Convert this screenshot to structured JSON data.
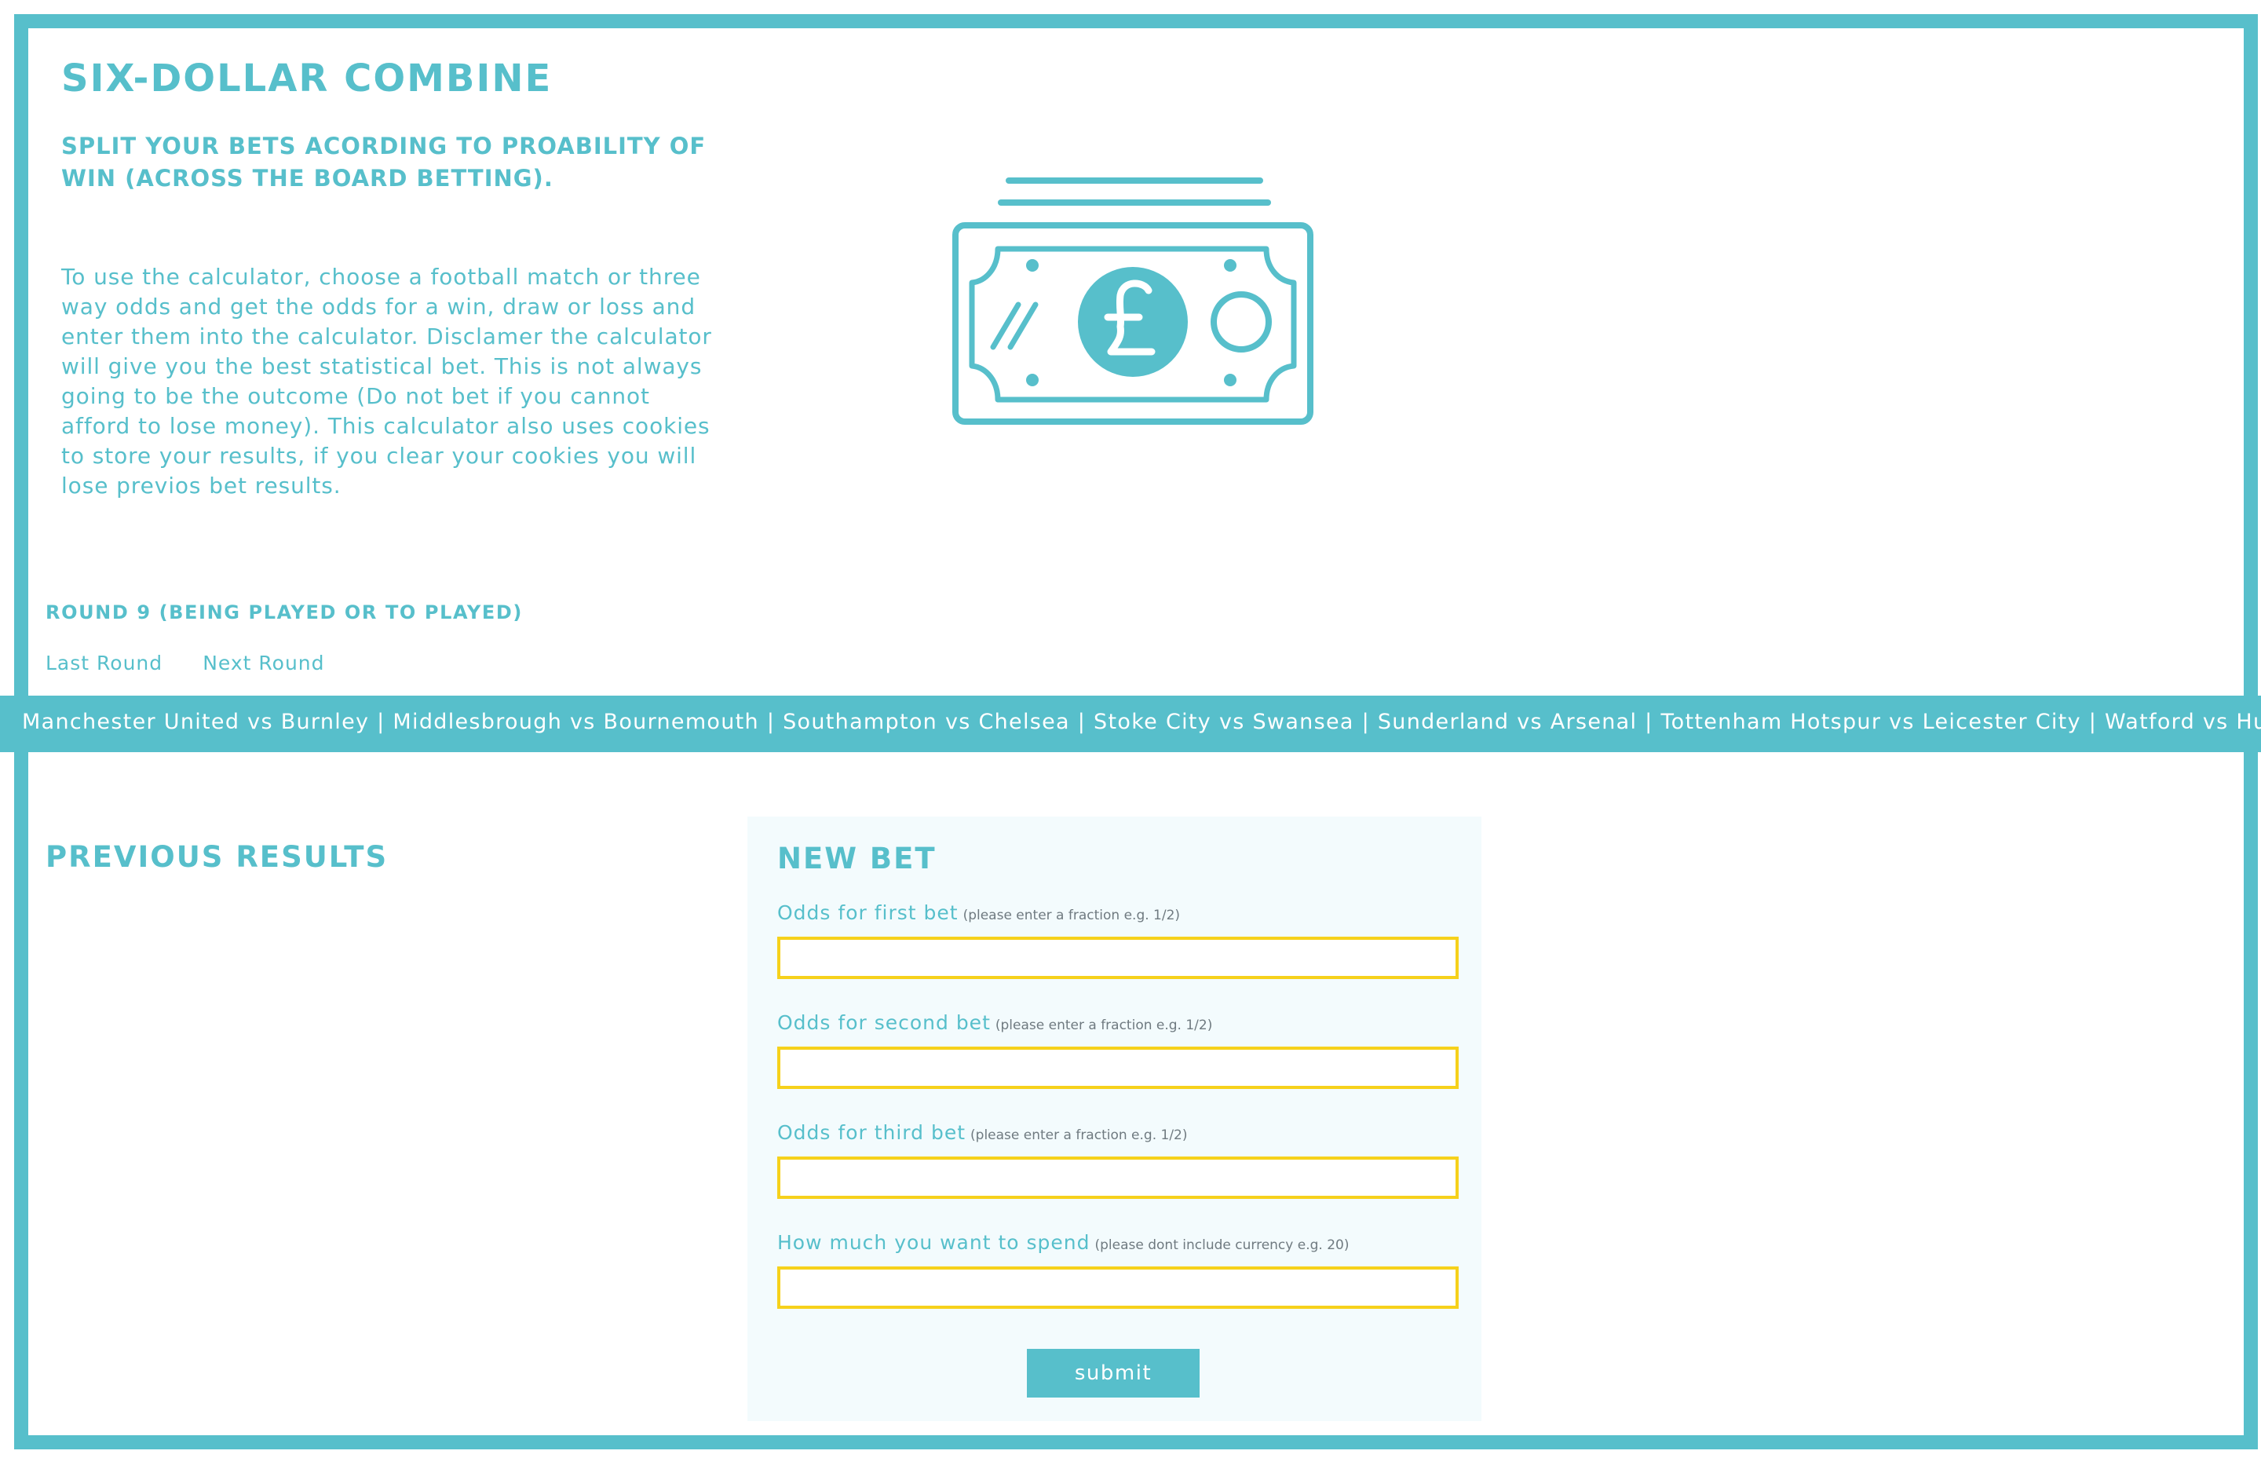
{
  "header": {
    "title": "SIX-DOLLAR COMBINE",
    "subtitle": "SPLIT YOUR BETS ACORDING TO PROABILITY OF WIN (ACROSS THE BOARD BETTING).",
    "intro": "To use the calculator, choose a football match or three way odds and get the odds for a win, draw or loss and enter them into the calculator. Disclamer the calculator will give you the best statistical bet. This is not always going to be the outcome (Do not bet if you cannot afford to lose money). This calculator also uses cookies to store your results, if you clear your cookies you will lose previos bet results."
  },
  "icons": {
    "hero": "banknote-pound-icon"
  },
  "round": {
    "heading": "ROUND 9 (BEING PLAYED OR TO PLAYED)",
    "last_label": "Last Round",
    "next_label": "Next Round"
  },
  "ticker": {
    "text": "Manchester United vs Burnley | Middlesbrough vs Bournemouth | Southampton vs Chelsea | Stoke City vs Swansea | Sunderland vs Arsenal | Tottenham Hotspur vs Leicester City | Watford vs Hull City | West Bromwich Albion vs Manchester City"
  },
  "previous_results": {
    "title": "PREVIOUS RESULTS"
  },
  "new_bet": {
    "title": "NEW BET",
    "fields": [
      {
        "label": "Odds for first bet",
        "hint": "(please enter a fraction e.g. 1/2)",
        "value": ""
      },
      {
        "label": "Odds for second bet",
        "hint": "(please enter a fraction e.g. 1/2)",
        "value": ""
      },
      {
        "label": "Odds for third bet",
        "hint": "(please enter a fraction e.g. 1/2)",
        "value": ""
      },
      {
        "label": "How much you want to spend",
        "hint": "(please dont include currency e.g. 20)",
        "value": ""
      }
    ],
    "submit_label": "submit"
  },
  "colors": {
    "accent": "#57bfcb",
    "input_border": "#f6d11b",
    "panel_bg": "#f3fbfd"
  }
}
